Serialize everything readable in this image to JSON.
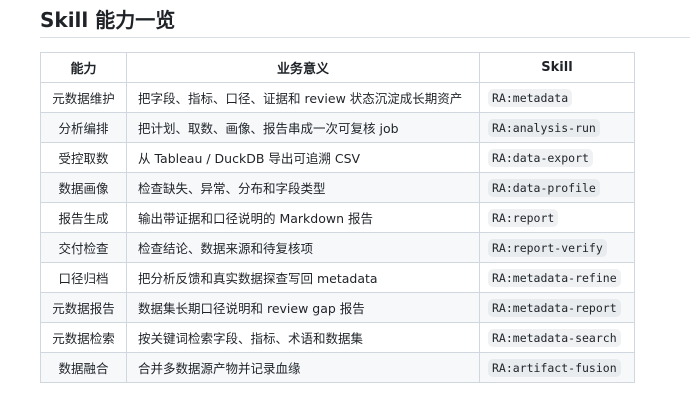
{
  "heading": "Skill 能力一览",
  "table": {
    "headers": [
      "能力",
      "业务意义",
      "Skill"
    ],
    "rows": [
      {
        "capability": "元数据维护",
        "meaning": "把字段、指标、口径、证据和 review 状态沉淀成长期资产",
        "skill": "RA:metadata"
      },
      {
        "capability": "分析编排",
        "meaning": "把计划、取数、画像、报告串成一次可复核 job",
        "skill": "RA:analysis-run"
      },
      {
        "capability": "受控取数",
        "meaning": "从 Tableau / DuckDB 导出可追溯 CSV",
        "skill": "RA:data-export"
      },
      {
        "capability": "数据画像",
        "meaning": "检查缺失、异常、分布和字段类型",
        "skill": "RA:data-profile"
      },
      {
        "capability": "报告生成",
        "meaning": "输出带证据和口径说明的 Markdown 报告",
        "skill": "RA:report"
      },
      {
        "capability": "交付检查",
        "meaning": "检查结论、数据来源和待复核项",
        "skill": "RA:report-verify"
      },
      {
        "capability": "口径归档",
        "meaning": "把分析反馈和真实数据探查写回 metadata",
        "skill": "RA:metadata-refine"
      },
      {
        "capability": "元数据报告",
        "meaning": "数据集长期口径说明和 review gap 报告",
        "skill": "RA:metadata-report"
      },
      {
        "capability": "元数据检索",
        "meaning": "按关键词检索字段、指标、术语和数据集",
        "skill": "RA:metadata-search"
      },
      {
        "capability": "数据融合",
        "meaning": "合并多数据源产物并记录血缘",
        "skill": "RA:artifact-fusion"
      }
    ]
  }
}
